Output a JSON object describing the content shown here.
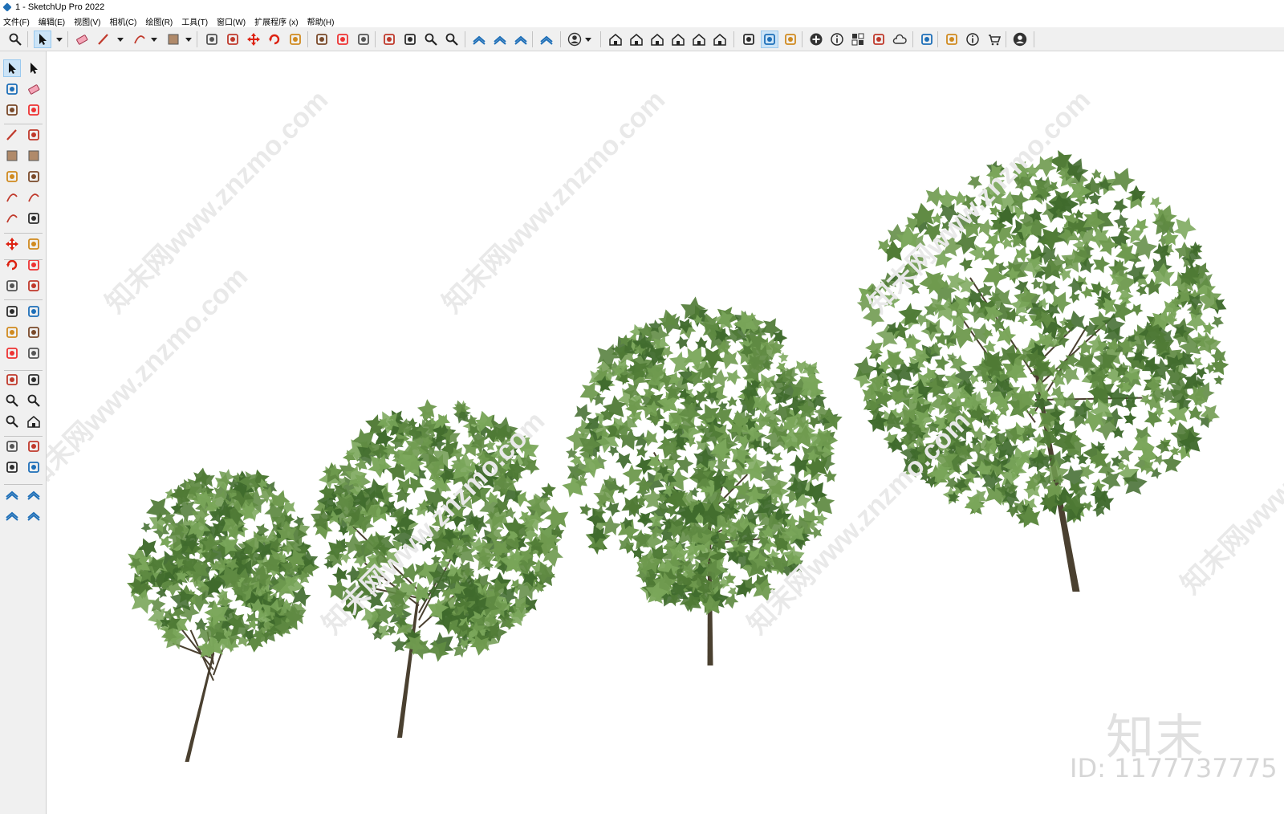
{
  "window": {
    "title": "1 - SketchUp Pro 2022"
  },
  "menu": [
    "文件(F)",
    "编辑(E)",
    "视图(V)",
    "相机(C)",
    "绘图(R)",
    "工具(T)",
    "窗口(W)",
    "扩展程序 (x)",
    "帮助(H)"
  ],
  "top_toolbar": [
    {
      "icon": "zoom-icon"
    },
    {
      "icon": "select-arrow-icon",
      "active": true
    },
    {
      "icon": "eraser-icon"
    },
    {
      "icon": "pencil-line-icon"
    },
    {
      "icon": "arc-icon"
    },
    {
      "icon": "rectangle-icon"
    },
    {
      "icon": "push-pull-icon"
    },
    {
      "icon": "follow-me-icon"
    },
    {
      "icon": "move-icon"
    },
    {
      "icon": "rotate-icon"
    },
    {
      "icon": "scale-icon"
    },
    {
      "icon": "tape-measure-icon"
    },
    {
      "icon": "text-icon"
    },
    {
      "icon": "paint-bucket-icon"
    },
    {
      "icon": "orbit-icon"
    },
    {
      "icon": "pan-icon"
    },
    {
      "icon": "zoom-tool-icon"
    },
    {
      "icon": "zoom-extents-icon"
    },
    {
      "icon": "sandbox-from-contours-icon"
    },
    {
      "icon": "sandbox-from-scratch-icon"
    },
    {
      "icon": "sandbox-smoove-icon"
    },
    {
      "icon": "sandbox-stamp-icon"
    },
    {
      "icon": "user-account-icon"
    },
    {
      "icon": "iso-view-icon"
    },
    {
      "icon": "top-view-icon"
    },
    {
      "icon": "front-view-icon"
    },
    {
      "icon": "right-view-icon"
    },
    {
      "icon": "back-view-icon"
    },
    {
      "icon": "left-view-icon"
    },
    {
      "icon": "section-plane-icon"
    },
    {
      "icon": "section-display-icon",
      "active": true
    },
    {
      "icon": "section-cuts-icon"
    },
    {
      "icon": "add-location-icon"
    },
    {
      "icon": "model-info-icon"
    },
    {
      "icon": "components-icon"
    },
    {
      "icon": "styles-icon"
    },
    {
      "icon": "cloud-upload-icon"
    },
    {
      "icon": "extension-settings-icon"
    },
    {
      "icon": "layout-icon"
    },
    {
      "icon": "info-icon"
    },
    {
      "icon": "extension-warehouse-icon"
    },
    {
      "icon": "account-icon"
    }
  ],
  "watermark": {
    "diagonal_text": "知末网www.znzmo.com",
    "brand": "知末",
    "id_text": "ID: 1177737775"
  },
  "scene": {
    "background": "#ffffff",
    "foliage_colors": [
      "#4f7a35",
      "#5f8a42",
      "#6f9a4f",
      "#3f6a2c",
      "#7aa65a"
    ],
    "trunk_color": "#4a4030",
    "trees": [
      {
        "label": "tree-1"
      },
      {
        "label": "tree-2"
      },
      {
        "label": "tree-3"
      },
      {
        "label": "tree-4"
      }
    ]
  }
}
